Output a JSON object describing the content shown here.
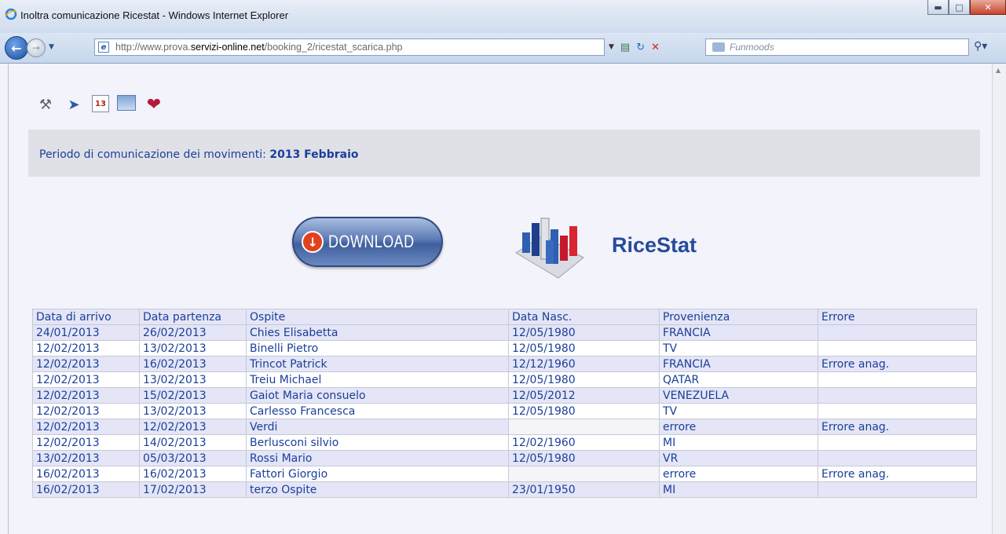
{
  "window": {
    "title": "Inoltra comunicazione Ricestat - Windows Internet Explorer",
    "controls": [
      "minimize",
      "maximize",
      "close"
    ]
  },
  "address_bar": {
    "url_prefix": "http://www.prova.",
    "url_domain": "servizi-online.net",
    "url_path": "/booking_2/ricestat_scarica.php"
  },
  "search": {
    "placeholder": "Funmoods"
  },
  "toolbar_icons": [
    "tools-icon",
    "wand-icon",
    "calendar-icon",
    "image-icon",
    "heart-icon"
  ],
  "period": {
    "label": "Periodo di comunicazione dei movimenti:",
    "value": "2013 Febbraio"
  },
  "download": {
    "label": "DOWNLOAD"
  },
  "brand": {
    "title": "RiceStat"
  },
  "table": {
    "headers": [
      "Data di arrivo",
      "Data partenza",
      "Ospite",
      "Data Nasc.",
      "Provenienza",
      "Errore"
    ],
    "rows": [
      [
        "24/01/2013",
        "26/02/2013",
        "Chies Elisabetta",
        "12/05/1980",
        "FRANCIA",
        ""
      ],
      [
        "12/02/2013",
        "13/02/2013",
        "Binelli Pietro",
        "12/05/1980",
        "TV",
        ""
      ],
      [
        "12/02/2013",
        "16/02/2013",
        "Trincot Patrick",
        "12/12/1960",
        "FRANCIA",
        "Errore anag."
      ],
      [
        "12/02/2013",
        "13/02/2013",
        "Treiu Michael",
        "12/05/1980",
        "QATAR",
        ""
      ],
      [
        "12/02/2013",
        "15/02/2013",
        "Gaiot Maria consuelo",
        "12/05/2012",
        "VENEZUELA",
        ""
      ],
      [
        "12/02/2013",
        "13/02/2013",
        "Carlesso Francesca",
        "12/05/1980",
        "TV",
        ""
      ],
      [
        "12/02/2013",
        "12/02/2013",
        "Verdi",
        "",
        "errore",
        "Errore anag."
      ],
      [
        "12/02/2013",
        "14/02/2013",
        "Berlusconi silvio",
        "12/02/1960",
        "MI",
        ""
      ],
      [
        "13/02/2013",
        "05/03/2013",
        "Rossi Mario",
        "12/05/1980",
        "VR",
        ""
      ],
      [
        "16/02/2013",
        "16/02/2013",
        "Fattori Giorgio",
        "",
        "errore",
        "Errore anag."
      ],
      [
        "16/02/2013",
        "17/02/2013",
        "terzo Ospite",
        "23/01/1950",
        "MI",
        ""
      ]
    ]
  }
}
